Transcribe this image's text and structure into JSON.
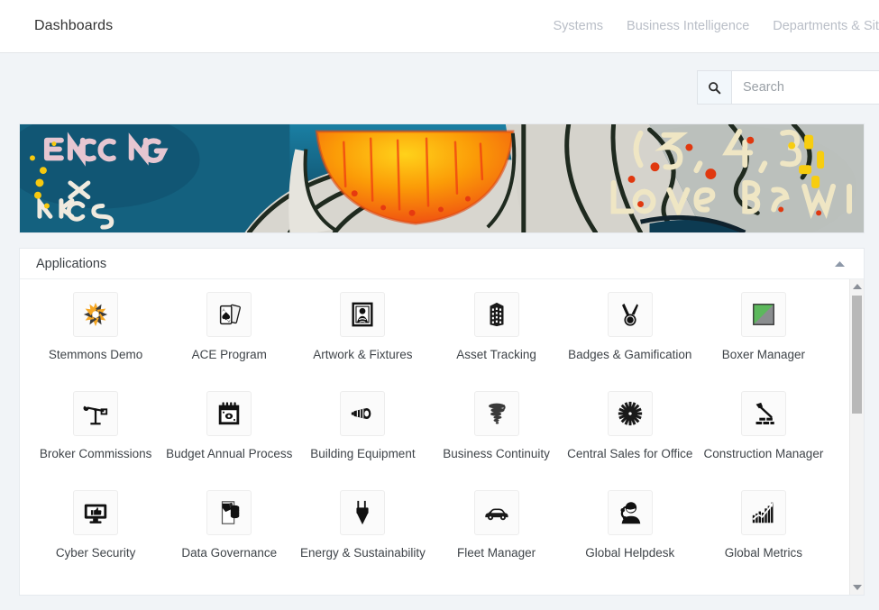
{
  "header": {
    "brand": "Dashboards",
    "nav": [
      {
        "label": "Systems"
      },
      {
        "label": "Business Intelligence"
      },
      {
        "label": "Departments & Site"
      }
    ]
  },
  "search": {
    "icon": "search-icon",
    "placeholder": "Search",
    "value": ""
  },
  "banner": {
    "alt": "street-art-banner",
    "graffiti_text_left": "ENCCNG",
    "graffiti_text_left2": "KIS",
    "graffiti_text_right": "(5, 4, 3",
    "graffiti_text_right2": "Love Be W",
    "colors": {
      "blue": "#1b6e8c",
      "deep_blue": "#0e4a66",
      "orange": "#f26b1d",
      "yellow": "#f5c400",
      "ink": "#1d2a22",
      "paper": "#dcdad3"
    }
  },
  "applications_panel": {
    "title": "Applications",
    "collapse_icon": "chevron-up-icon",
    "scrollbar": {
      "up_icon": "triangle-up-icon",
      "down_icon": "triangle-down-icon"
    },
    "apps": [
      {
        "label": "Stemmons Demo",
        "icon": "pinwheel-icon"
      },
      {
        "label": "ACE Program",
        "icon": "playing-cards-icon"
      },
      {
        "label": "Artwork & Fixtures",
        "icon": "framed-painting-icon"
      },
      {
        "label": "Asset Tracking",
        "icon": "building-icon"
      },
      {
        "label": "Badges & Gamification",
        "icon": "medal-icon"
      },
      {
        "label": "Boxer Manager",
        "icon": "green-gray-square-icon"
      },
      {
        "label": "Broker Commissions",
        "icon": "scale-balance-icon"
      },
      {
        "label": "Budget Annual Process",
        "icon": "calendar-money-icon"
      },
      {
        "label": "Building Equipment",
        "icon": "duct-pipe-icon"
      },
      {
        "label": "Business Continuity",
        "icon": "tornado-icon"
      },
      {
        "label": "Central Sales for Office",
        "icon": "gear-sunburst-icon"
      },
      {
        "label": "Construction Manager",
        "icon": "hammer-bricks-icon"
      },
      {
        "label": "Cyber Security",
        "icon": "monitor-thumbsup-icon"
      },
      {
        "label": "Data Governance",
        "icon": "document-database-icon"
      },
      {
        "label": "Energy & Sustainability",
        "icon": "power-plug-icon"
      },
      {
        "label": "Fleet Manager",
        "icon": "car-icon"
      },
      {
        "label": "Global Helpdesk",
        "icon": "headset-agent-icon"
      },
      {
        "label": "Global Metrics",
        "icon": "bar-chart-trend-icon"
      }
    ]
  },
  "theme": {
    "page_bg": "#f1f4f7",
    "card_bg": "#ffffff",
    "accent_green": "#5cb85c",
    "accent_orange": "#f5a623",
    "nav_text": "#b9bec7"
  }
}
